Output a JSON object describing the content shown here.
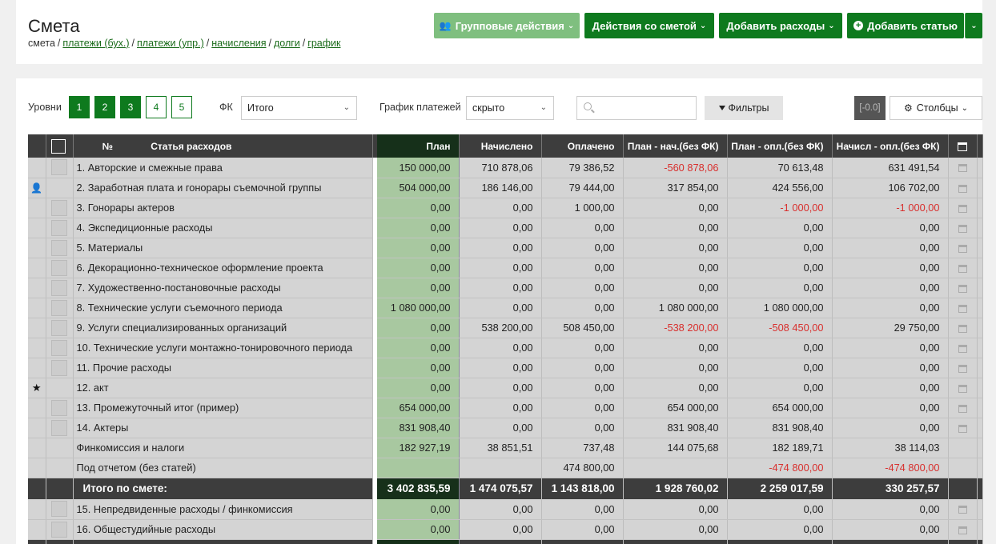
{
  "header": {
    "title": "Смета",
    "crumbs": {
      "current": "смета",
      "links": [
        "платежи (бух.)",
        "платежи (упр.)",
        "начисления",
        "долги",
        "график"
      ],
      "sep": "/"
    },
    "buttons": {
      "group": "Групповые действия",
      "smeta": "Действия со сметой",
      "expenses": "Добавить расходы",
      "article": "Добавить статью"
    }
  },
  "toolbar": {
    "levels_label": "Уровни",
    "levels": [
      "1",
      "2",
      "3",
      "4",
      "5"
    ],
    "active_levels": 3,
    "fk_label": "ФК",
    "fk_value": "Итого",
    "schedule_label": "График платежей",
    "schedule_value": "скрыто",
    "search_placeholder": "",
    "filters": "Фильтры",
    "version": "[-0.0]",
    "columns": "Столбцы"
  },
  "table": {
    "headers": {
      "no": "№",
      "article": "Статья расходов",
      "plan": "План",
      "accrued": "Начислено",
      "paid": "Оплачено",
      "plan_accr": "План - нач.(без ФК)",
      "plan_paid": "План - опл.(без ФК)",
      "accr_paid": "Начисл - опл.(без ФК)"
    },
    "rows": [
      {
        "name": "1. Авторские и смежные права",
        "plan": "150 000,00",
        "accrued": "710 878,06",
        "paid": "79 386,52",
        "plan_accr": "-560 878,06",
        "plan_paid": "70 613,48",
        "accr_paid": "631 491,54",
        "icon": "",
        "chk": true,
        "cal": true
      },
      {
        "name": "2. Заработная плата и гонорары съемочной группы",
        "plan": "504 000,00",
        "accrued": "186 146,00",
        "paid": "79 444,00",
        "plan_accr": "317 854,00",
        "plan_paid": "424 556,00",
        "accr_paid": "106 702,00",
        "icon": "person-icon",
        "chk": false,
        "cal": true
      },
      {
        "name": "3. Гонорары актеров",
        "plan": "0,00",
        "accrued": "0,00",
        "paid": "1 000,00",
        "plan_accr": "0,00",
        "plan_paid": "-1 000,00",
        "accr_paid": "-1 000,00",
        "icon": "",
        "chk": true,
        "cal": true
      },
      {
        "name": "4. Экспедиционные расходы",
        "plan": "0,00",
        "accrued": "0,00",
        "paid": "0,00",
        "plan_accr": "0,00",
        "plan_paid": "0,00",
        "accr_paid": "0,00",
        "icon": "",
        "chk": true,
        "cal": true
      },
      {
        "name": "5. Материалы",
        "plan": "0,00",
        "accrued": "0,00",
        "paid": "0,00",
        "plan_accr": "0,00",
        "plan_paid": "0,00",
        "accr_paid": "0,00",
        "icon": "",
        "chk": true,
        "cal": true
      },
      {
        "name": "6. Декорационно-техническое оформление проекта",
        "plan": "0,00",
        "accrued": "0,00",
        "paid": "0,00",
        "plan_accr": "0,00",
        "plan_paid": "0,00",
        "accr_paid": "0,00",
        "icon": "",
        "chk": true,
        "cal": true
      },
      {
        "name": "7. Художественно-постановочные расходы",
        "plan": "0,00",
        "accrued": "0,00",
        "paid": "0,00",
        "plan_accr": "0,00",
        "plan_paid": "0,00",
        "accr_paid": "0,00",
        "icon": "",
        "chk": true,
        "cal": true
      },
      {
        "name": "8. Технические услуги съемочного периода",
        "plan": "1 080 000,00",
        "accrued": "0,00",
        "paid": "0,00",
        "plan_accr": "1 080 000,00",
        "plan_paid": "1 080 000,00",
        "accr_paid": "0,00",
        "icon": "",
        "chk": true,
        "cal": true
      },
      {
        "name": "9. Услуги специализированных организаций",
        "plan": "0,00",
        "accrued": "538 200,00",
        "paid": "508 450,00",
        "plan_accr": "-538 200,00",
        "plan_paid": "-508 450,00",
        "accr_paid": "29 750,00",
        "icon": "",
        "chk": true,
        "cal": true
      },
      {
        "name": "10. Технические услуги монтажно-тонировочного периода",
        "plan": "0,00",
        "accrued": "0,00",
        "paid": "0,00",
        "plan_accr": "0,00",
        "plan_paid": "0,00",
        "accr_paid": "0,00",
        "icon": "",
        "chk": true,
        "cal": true
      },
      {
        "name": "11. Прочие расходы",
        "plan": "0,00",
        "accrued": "0,00",
        "paid": "0,00",
        "plan_accr": "0,00",
        "plan_paid": "0,00",
        "accr_paid": "0,00",
        "icon": "",
        "chk": true,
        "cal": true
      },
      {
        "name": "12. акт",
        "plan": "0,00",
        "accrued": "0,00",
        "paid": "0,00",
        "plan_accr": "0,00",
        "plan_paid": "0,00",
        "accr_paid": "0,00",
        "icon": "star-icon",
        "chk": false,
        "cal": true
      },
      {
        "name": "13. Промежуточный итог (пример)",
        "plan": "654 000,00",
        "accrued": "0,00",
        "paid": "0,00",
        "plan_accr": "654 000,00",
        "plan_paid": "654 000,00",
        "accr_paid": "0,00",
        "icon": "",
        "chk": true,
        "cal": true
      },
      {
        "name": "14. Актеры",
        "plan": "831 908,40",
        "accrued": "0,00",
        "paid": "0,00",
        "plan_accr": "831 908,40",
        "plan_paid": "831 908,40",
        "accr_paid": "0,00",
        "icon": "",
        "chk": true,
        "cal": true
      },
      {
        "name": "Финкомиссия и налоги",
        "plan": "182 927,19",
        "accrued": "38 851,51",
        "paid": "737,48",
        "plan_accr": "144 075,68",
        "plan_paid": "182 189,71",
        "accr_paid": "38 114,03",
        "icon": "",
        "chk": false,
        "cal": false
      },
      {
        "name": "Под отчетом (без статей)",
        "plan": "",
        "accrued": "",
        "paid": "474 800,00",
        "plan_accr": "",
        "plan_paid": "-474 800,00",
        "accr_paid": "-474 800,00",
        "icon": "",
        "chk": false,
        "cal": false
      }
    ],
    "total": {
      "name": "Итого по смете:",
      "plan": "3 402 835,59",
      "accrued": "1 474 075,57",
      "paid": "1 143 818,00",
      "plan_accr": "1 928 760,02",
      "plan_paid": "2 259 017,59",
      "accr_paid": "330 257,57"
    },
    "rows2": [
      {
        "name": "15. Непредвиденные расходы / финкомиссия",
        "plan": "0,00",
        "accrued": "0,00",
        "paid": "0,00",
        "plan_accr": "0,00",
        "plan_paid": "0,00",
        "accr_paid": "0,00",
        "icon": "",
        "chk": true,
        "cal": true
      },
      {
        "name": "16. Общестудийные расходы",
        "plan": "0,00",
        "accrued": "0,00",
        "paid": "0,00",
        "plan_accr": "0,00",
        "plan_paid": "0,00",
        "accr_paid": "0,00",
        "icon": "",
        "chk": true,
        "cal": true
      }
    ]
  },
  "colors": {
    "accent": "#0e7a1e",
    "accent_light": "#7fbf7f",
    "negative": "#d8302e",
    "plan_col": "#a8c8a0",
    "header_bg": "#3d3d3d"
  }
}
